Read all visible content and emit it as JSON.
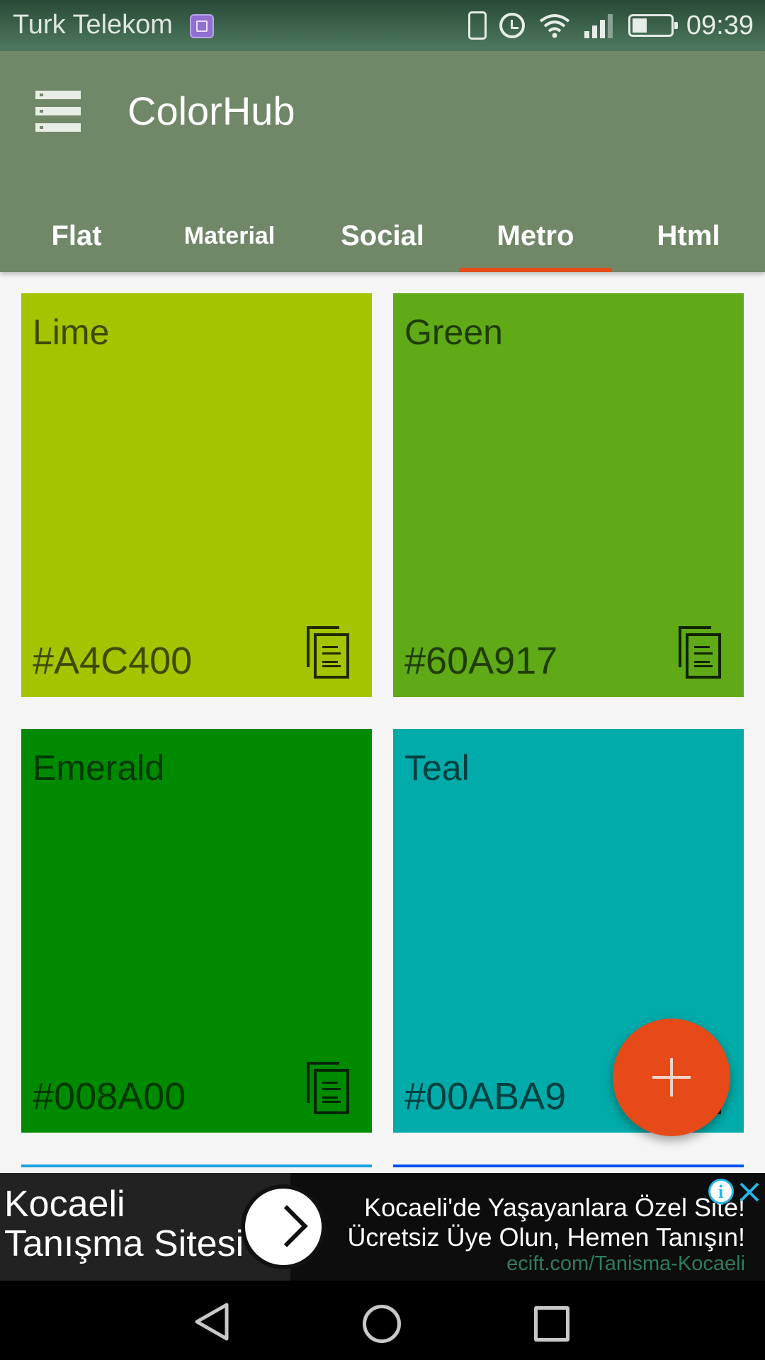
{
  "status_bar": {
    "carrier": "Turk Telekom",
    "time": "09:39",
    "icons": [
      "gallery-icon",
      "vibrate-icon",
      "alarm-icon",
      "wifi-icon",
      "signal-icon",
      "battery-icon"
    ]
  },
  "app_bar": {
    "title": "ColorHub",
    "menu_icon": "menu-icon",
    "background_color": "#708868"
  },
  "tabs": [
    {
      "label": "Flat",
      "active": false
    },
    {
      "label": "Material",
      "active": false
    },
    {
      "label": "Social",
      "active": false
    },
    {
      "label": "Metro",
      "active": true
    },
    {
      "label": "Html",
      "active": false
    }
  ],
  "accent_color": "#e64a19",
  "colors": [
    {
      "name": "Lime",
      "hex": "#A4C400",
      "swatch": "#A4C400"
    },
    {
      "name": "Green",
      "hex": "#60A917",
      "swatch": "#60A917"
    },
    {
      "name": "Emerald",
      "hex": "#008A00",
      "swatch": "#008A00"
    },
    {
      "name": "Teal",
      "hex": "#00ABA9",
      "swatch": "#00ABA9"
    }
  ],
  "next_row_colors": [
    "#1BA1E2",
    "#0050EF"
  ],
  "fab": {
    "icon": "plus-icon"
  },
  "ad": {
    "headline": "Kocaeli Tanışma Sitesi",
    "line1": "Kocaeli'de Yaşayanlara Özel Site!",
    "line2": "Ücretsiz Üye Olun, Hemen Tanışın!",
    "url": "ecift.com/Tanisma-Kocaeli",
    "icons": [
      "arrow-right-icon",
      "info-icon",
      "close-icon"
    ]
  },
  "nav_bar": {
    "icons": [
      "back-icon",
      "home-icon",
      "recent-apps-icon"
    ]
  }
}
